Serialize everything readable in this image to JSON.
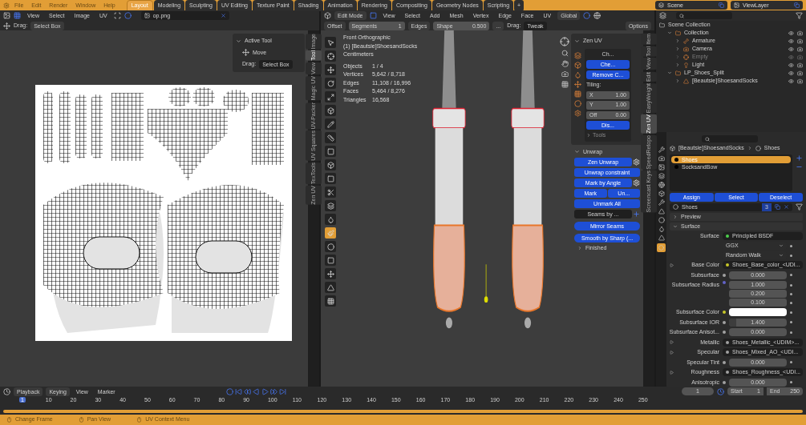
{
  "topbar": {
    "menus": [
      "File",
      "Edit",
      "Render",
      "Window",
      "Help"
    ],
    "workspaces": [
      {
        "label": "Layout",
        "selected": true
      },
      {
        "label": "Modeling",
        "selected": false
      },
      {
        "label": "Sculpting",
        "selected": false
      },
      {
        "label": "UV Editing",
        "selected": false
      },
      {
        "label": "Texture Paint",
        "selected": false
      },
      {
        "label": "Shading",
        "selected": false
      },
      {
        "label": "Animation",
        "selected": false
      },
      {
        "label": "Rendering",
        "selected": false
      },
      {
        "label": "Compositing",
        "selected": false
      },
      {
        "label": "Geometry Nodes",
        "selected": false
      },
      {
        "label": "Scripting",
        "selected": false
      }
    ],
    "add_label": "+",
    "scene": "Scene",
    "view_layer": "ViewLayer"
  },
  "uv_editor": {
    "menus": [
      "View",
      "Select",
      "Image",
      "UV"
    ],
    "image_name": "op.png",
    "drag_label": "Drag:",
    "drag_value": "Select Box",
    "panel": {
      "title": "Active Tool",
      "tool": "Move",
      "drag_label": "Drag:",
      "drag_value": "Select Box"
    },
    "tabs": [
      {
        "label": "Image",
        "selected": false
      },
      {
        "label": "Tool",
        "selected": true
      },
      {
        "label": "View",
        "selected": false
      },
      {
        "label": "Magic UV",
        "selected": false
      },
      {
        "label": "UV-Packer",
        "selected": false
      },
      {
        "label": "UV Squares",
        "selected": false
      },
      {
        "label": "TexTools",
        "selected": false
      },
      {
        "label": "Zen UV",
        "selected": false
      }
    ]
  },
  "viewport": {
    "mode": "Edit Mode",
    "menus": [
      "View",
      "Select",
      "Add",
      "Mesh",
      "Vertex",
      "Edge",
      "Face",
      "UV"
    ],
    "orientation": "Global",
    "options": "Options",
    "tool_settings": [
      {
        "kind": "button",
        "label": "Offset"
      },
      {
        "kind": "field",
        "label": "Segments",
        "value": "1"
      },
      {
        "kind": "button",
        "label": "Edges"
      },
      {
        "kind": "field",
        "label": "Shape",
        "value": "0.500"
      },
      {
        "kind": "button",
        "label": "..."
      },
      {
        "kind": "drag",
        "label": "Drag:",
        "value": "Tweak"
      }
    ],
    "overlay": {
      "view": "Front Orthographic",
      "object": "(1) [Beautsie]ShoesandSocks",
      "units": "Centimeters",
      "stats": [
        {
          "label": "Objects",
          "value": "1 / 4"
        },
        {
          "label": "Vertices",
          "value": "5,642 / 8,718"
        },
        {
          "label": "Edges",
          "value": "11,108 / 16,996"
        },
        {
          "label": "Faces",
          "value": "5,464 / 8,276"
        },
        {
          "label": "Triangles",
          "value": "16,568"
        }
      ]
    },
    "zen_uv": {
      "title": "Zen UV",
      "header": "Ch...",
      "check": "Che...",
      "remove": "Remove C...",
      "tiling_label": "Tiling:",
      "tiling": [
        {
          "axis": "X",
          "value": "1.00"
        },
        {
          "axis": "Y",
          "value": "1.00"
        }
      ],
      "offset": "Off",
      "offset_value": "0.00",
      "display": "Dis...",
      "tools": "Tools"
    },
    "unwrap": {
      "title": "Unwrap",
      "buttons": [
        {
          "kind": "gear",
          "label": "Zen Unwrap"
        },
        {
          "kind": "plain",
          "label": "Unwrap constraint"
        },
        {
          "kind": "gear",
          "label": "Mark by Angle"
        },
        {
          "kind": "pair",
          "label": "Mark",
          "second": "Un..."
        },
        {
          "kind": "plain",
          "label": "Unmark All"
        },
        {
          "kind": "dropdown",
          "label": "Seams by ..."
        },
        {
          "kind": "round",
          "label": "Mirror Seams"
        },
        {
          "kind": "round",
          "label": "Smooth by Sharp (..."
        }
      ],
      "finished": "Finished"
    },
    "tabs": [
      {
        "label": "Item",
        "selected": false
      },
      {
        "label": "Tool",
        "selected": false
      },
      {
        "label": "View",
        "selected": false
      },
      {
        "label": "Edit",
        "selected": false
      },
      {
        "label": "EasyWeight",
        "selected": false
      },
      {
        "label": "Zen UV",
        "selected": true
      },
      {
        "label": "SpeedRetopo",
        "selected": false
      },
      {
        "label": "Screencast Keys",
        "selected": false
      }
    ]
  },
  "outliner": {
    "root": "Scene Collection",
    "items": [
      {
        "name": "Collection",
        "kind": "collection",
        "dimmed": false,
        "expanded": true,
        "children": [
          {
            "name": "Armature",
            "kind": "armature",
            "dimmed": false,
            "expanded": false
          },
          {
            "name": "Camera",
            "kind": "camera",
            "dimmed": false,
            "expanded": false
          },
          {
            "name": "Empty",
            "kind": "empty",
            "dimmed": true,
            "expanded": false
          },
          {
            "name": "Light",
            "kind": "light",
            "dimmed": false,
            "expanded": false
          }
        ]
      },
      {
        "name": "LP_Shoes_Split",
        "kind": "collection",
        "dimmed": false,
        "expanded": true,
        "children": [
          {
            "name": "[Beautsie]ShoesandSocks",
            "kind": "mesh",
            "dimmed": false,
            "expanded": false
          }
        ]
      }
    ]
  },
  "properties": {
    "object": "[Beautsie]ShoesandSocks",
    "material": "Shoes",
    "slots": [
      {
        "name": "Shoes",
        "selected": true
      },
      {
        "name": "SocksandBow",
        "selected": false
      }
    ],
    "slot_buttons": [
      "Assign",
      "Select",
      "Deselect"
    ],
    "material_name": "Shoes",
    "users": "3",
    "sections": [
      {
        "title": "Preview",
        "expanded": false
      },
      {
        "title": "Surface",
        "expanded": true
      }
    ],
    "rows": [
      {
        "kind": "link",
        "label": "Surface",
        "value": "Principled BSDF",
        "color": "#4ccf4c",
        "expandable": false
      },
      {
        "kind": "dropdown",
        "value": "GGX"
      },
      {
        "kind": "dropdown",
        "value": "Random Walk"
      },
      {
        "kind": "link",
        "label": "Base Color",
        "value": "Shoes_Base_color_<UDI...",
        "color": "#c7c729",
        "expandable": true
      },
      {
        "kind": "number",
        "label": "Subsurface",
        "value": "0.000",
        "color": "#a1a1a1"
      },
      {
        "kind": "vector",
        "label": "Subsurface Radius",
        "values": [
          "1.000",
          "0.200",
          "0.100"
        ],
        "color": "#6363c7"
      },
      {
        "kind": "color",
        "label": "Subsurface Color",
        "color": "#c7c729"
      },
      {
        "kind": "number",
        "label": "Subsurface IOR",
        "value": "1.400",
        "level": 0.12,
        "color": "#a1a1a1"
      },
      {
        "kind": "number",
        "label": "Subsurface Anisot...",
        "value": "0.000",
        "color": "#a1a1a1"
      },
      {
        "kind": "link",
        "label": "Metallic",
        "value": "Shoes_Metallic_<UDIM>...",
        "color": "#a1a1a1",
        "expandable": true
      },
      {
        "kind": "link",
        "label": "Specular",
        "value": "Shoes_Mixed_AO_<UDI...",
        "color": "#a1a1a1",
        "expandable": true
      },
      {
        "kind": "number",
        "label": "Specular Tint",
        "value": "0.000",
        "color": "#a1a1a1"
      },
      {
        "kind": "link",
        "label": "Roughness",
        "value": "Shoes_Roughness_<UDI...",
        "color": "#a1a1a1",
        "expandable": true
      },
      {
        "kind": "number",
        "label": "Anisotropic",
        "value": "0.000",
        "color": "#a1a1a1"
      }
    ]
  },
  "timeline": {
    "menus": [
      "Playback",
      "Keying",
      "View",
      "Marker"
    ],
    "frame": "1",
    "start_label": "Start",
    "start": "1",
    "end_label": "End",
    "end": "250",
    "ruler": [
      {
        "label": "1",
        "current": true
      },
      {
        "label": "10",
        "current": false
      },
      {
        "label": "20",
        "current": false
      },
      {
        "label": "30",
        "current": false
      },
      {
        "label": "40",
        "current": false
      },
      {
        "label": "50",
        "current": false
      },
      {
        "label": "60",
        "current": false
      },
      {
        "label": "70",
        "current": false
      },
      {
        "label": "80",
        "current": false
      },
      {
        "label": "90",
        "current": false
      },
      {
        "label": "100",
        "current": false
      },
      {
        "label": "110",
        "current": false
      },
      {
        "label": "120",
        "current": false
      },
      {
        "label": "130",
        "current": false
      },
      {
        "label": "140",
        "current": false
      },
      {
        "label": "150",
        "current": false
      },
      {
        "label": "160",
        "current": false
      },
      {
        "label": "170",
        "current": false
      },
      {
        "label": "180",
        "current": false
      },
      {
        "label": "190",
        "current": false
      },
      {
        "label": "200",
        "current": false
      },
      {
        "label": "210",
        "current": false
      },
      {
        "label": "220",
        "current": false
      },
      {
        "label": "230",
        "current": false
      },
      {
        "label": "240",
        "current": false
      },
      {
        "label": "250",
        "current": false
      }
    ]
  },
  "status_bar": [
    "Change Frame",
    "Pan View",
    "UV Context Menu"
  ]
}
